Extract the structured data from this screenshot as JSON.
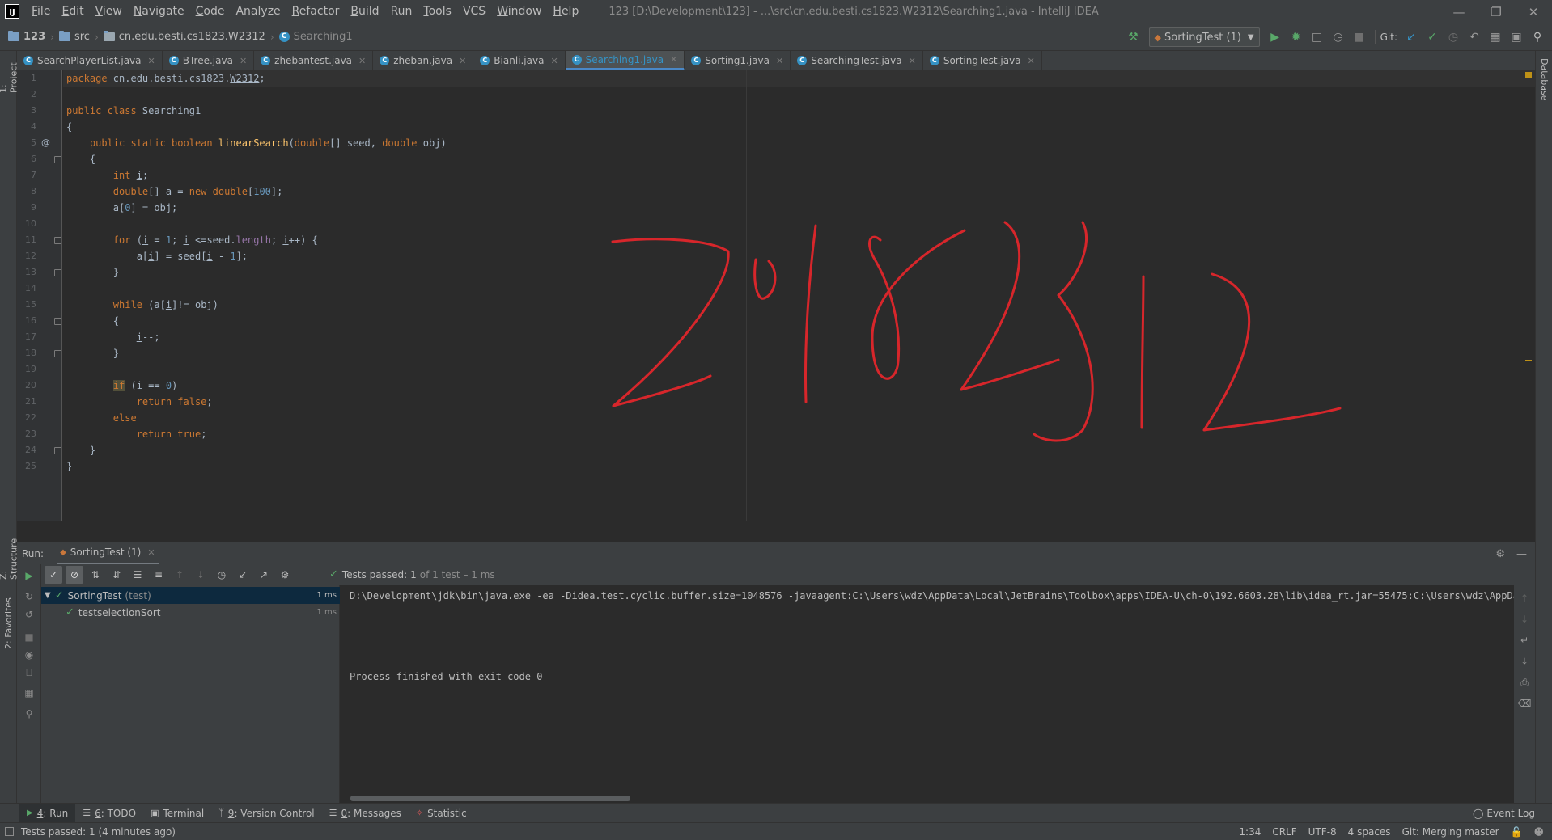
{
  "menu": {
    "items": [
      {
        "mn": "F",
        "rest": "ile"
      },
      {
        "mn": "E",
        "rest": "dit"
      },
      {
        "mn": "V",
        "rest": "iew"
      },
      {
        "mn": "N",
        "rest": "avigate"
      },
      {
        "mn": "C",
        "rest": "ode"
      },
      {
        "mn": "",
        "rest": "Analyze"
      },
      {
        "mn": "R",
        "rest": "efactor"
      },
      {
        "mn": "B",
        "rest": "uild"
      },
      {
        "mn": "",
        "rest": "Run"
      },
      {
        "mn": "T",
        "rest": "ools"
      },
      {
        "mn": "",
        "rest": "VCS"
      },
      {
        "mn": "W",
        "rest": "indow"
      },
      {
        "mn": "H",
        "rest": "elp"
      }
    ],
    "app_logo": "IJ"
  },
  "window_title": "123 [D:\\Development\\123] - ...\\src\\cn.edu.besti.cs1823.W2312\\Searching1.java - IntelliJ IDEA",
  "nav": {
    "crumbs": [
      "123",
      "src",
      "cn.edu.besti.cs1823.W2312",
      "Searching1"
    ],
    "run_config": "SortingTest (1)",
    "git_label": "Git:"
  },
  "tabs": [
    {
      "label": "SearchPlayerList.java"
    },
    {
      "label": "BTree.java"
    },
    {
      "label": "zhebantest.java"
    },
    {
      "label": "zheban.java"
    },
    {
      "label": "Bianli.java"
    },
    {
      "label": "Searching1.java"
    },
    {
      "label": "Sorting1.java"
    },
    {
      "label": "SearchingTest.java"
    },
    {
      "label": "SortingTest.java"
    }
  ],
  "side_tabs": {
    "project": "1: Project",
    "structure": "Z: Structure",
    "favorites": "2: Favorites",
    "database": "Database"
  },
  "editor": {
    "line_numbers": [
      "1",
      "2",
      "3",
      "4",
      "5",
      "6",
      "7",
      "8",
      "9",
      "10",
      "11",
      "12",
      "13",
      "14",
      "15",
      "16",
      "17",
      "18",
      "19",
      "20",
      "21",
      "22",
      "23",
      "24",
      "25"
    ],
    "gutter_marker": "@",
    "handwriting_color": "#d7262b"
  },
  "run": {
    "label": "Run:",
    "tab": "SortingTest (1)",
    "status_passed": "Tests passed:",
    "status_count": "1",
    "status_rest": "of 1 test – 1 ms",
    "tree": [
      {
        "name": "SortingTest",
        "suffix": "(test)",
        "time": "1 ms"
      },
      {
        "name": "testselectionSort",
        "suffix": "",
        "time": "1 ms"
      }
    ],
    "console": [
      "D:\\Development\\jdk\\bin\\java.exe -ea -Didea.test.cyclic.buffer.size=1048576 -javaagent:C:\\Users\\wdz\\AppData\\Local\\JetBrains\\Toolbox\\apps\\IDEA-U\\ch-0\\192.6603.28\\lib\\idea_rt.jar=55475:C:\\Users\\wdz\\AppData\\Lo",
      "Process finished with exit code 0"
    ]
  },
  "tool_windows": [
    {
      "mn": "4",
      "rest": ": Run"
    },
    {
      "mn": "6",
      "rest": ": TODO"
    },
    {
      "mn": "",
      "rest": "Terminal"
    },
    {
      "mn": "9",
      "rest": ": Version Control"
    },
    {
      "mn": "0",
      "rest": ": Messages"
    },
    {
      "mn": "",
      "rest": "Statistic"
    }
  ],
  "event_log": "Event Log",
  "status": {
    "message": "Tests passed: 1 (4 minutes ago)",
    "position": "1:34",
    "line_sep": "CRLF",
    "encoding": "UTF-8",
    "indent": "4 spaces",
    "git": "Git: Merging master"
  }
}
